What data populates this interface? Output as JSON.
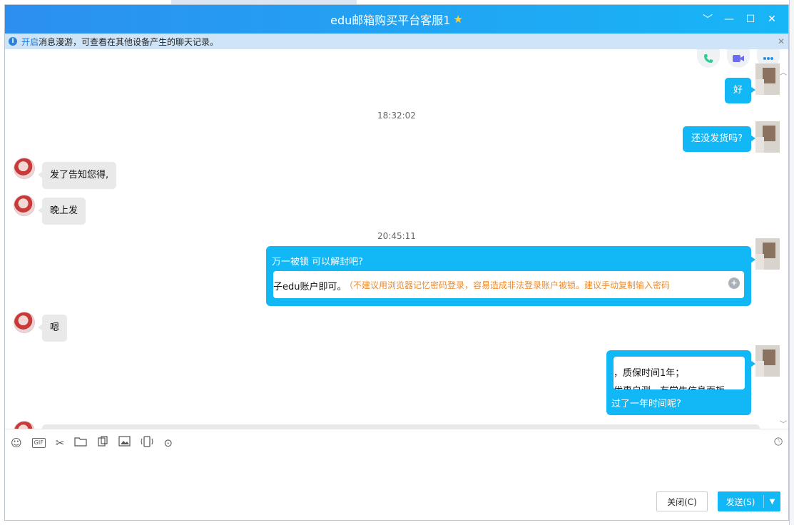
{
  "window": {
    "title": "edu邮箱购买平台客服1",
    "controls": [
      "﹀",
      "—",
      "☐",
      "✕"
    ]
  },
  "infobar": {
    "link": "开启",
    "text": "消息漫游，可查看在其他设备产生的聊天记录。",
    "close": "✕"
  },
  "messages": {
    "m1": "好",
    "t1": "18:32:02",
    "m2": "还没发货吗?",
    "m3": "发了告知您得,",
    "m4": "晚上发",
    "t2": "20:45:11",
    "m5": "万一被锁 可以解封吧?",
    "m5_quote_a": "子edu账户即可。",
    "m5_quote_b": "（不建议用浏览器记忆密码登录，容易造成非法登录账户被锁。建议手动复制输入密码",
    "m6": "嗯",
    "m7_quote_1": "，质保时间1年；",
    "m7_quote_2": "优惠自测，有学生信息面板",
    "m7": "过了一年时间呢?"
  },
  "toolbar_icons": [
    "smile-icon",
    "gif-icon",
    "scissors-icon",
    "folder-icon",
    "file-icon",
    "image-icon",
    "shake-icon",
    "more-icon",
    "history-icon"
  ],
  "toolbar": {
    "gif": "GIF"
  },
  "buttons": {
    "close": "关闭(C)",
    "send": "发送(S)"
  },
  "colors": {
    "title_gradient": [
      "#2c8ff0",
      "#18b6f6"
    ],
    "bubble_self": "#12b7f5",
    "bubble_other": "#e9e9e9",
    "warning_text": "#f08a28",
    "info_link": "#1c7ad8"
  }
}
